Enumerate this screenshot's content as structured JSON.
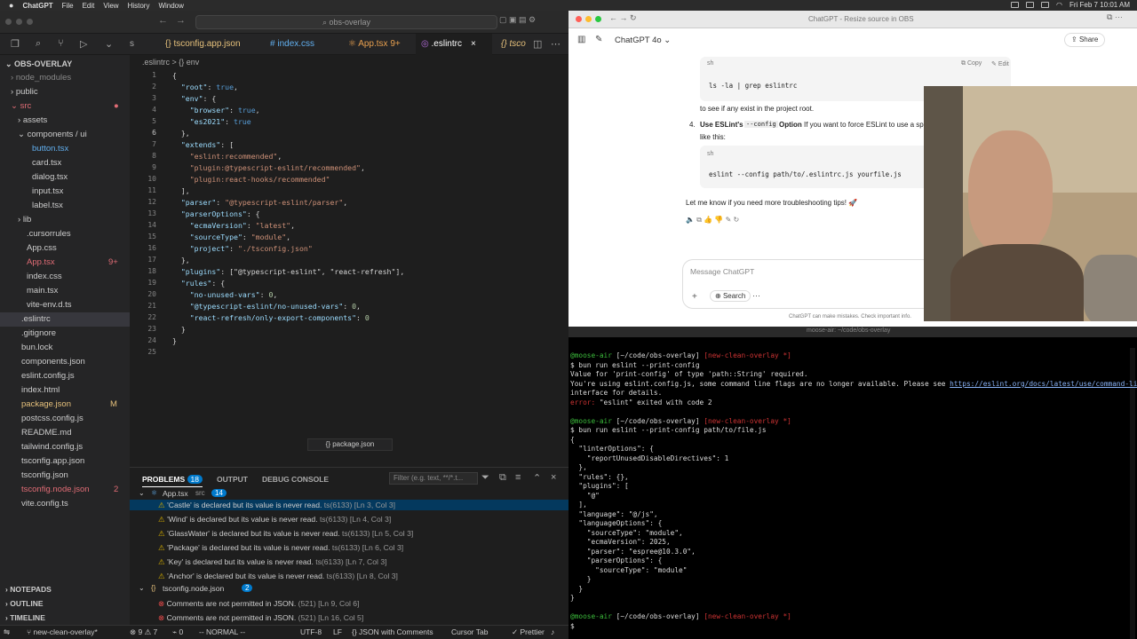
{
  "menubar": {
    "app": "ChatGPT",
    "items": [
      "File",
      "Edit",
      "View",
      "History",
      "Window"
    ],
    "clock": "Fri Feb 7  10:01 AM"
  },
  "vscode": {
    "search_placeholder": "obs-overlay",
    "tabs": [
      {
        "label": "s"
      },
      {
        "label": "tsconfig.app.json"
      },
      {
        "label": "index.css"
      },
      {
        "label": "App.tsx 9+"
      },
      {
        "label": ".eslintrc"
      },
      {
        "label": "tsco"
      }
    ],
    "explorer_title": "OBS-OVERLAY",
    "tree": [
      "node_modules",
      "public",
      "src",
      "assets",
      "components / ui",
      "button.tsx",
      "card.tsx",
      "dialog.tsx",
      "input.tsx",
      "label.tsx",
      "lib",
      ".cursorrules",
      "App.css",
      "App.tsx",
      "index.css",
      "main.tsx",
      "vite-env.d.ts",
      ".eslintrc",
      ".gitignore",
      "bun.lock",
      "components.json",
      "eslint.config.js",
      "index.html",
      "package.json",
      "postcss.config.js",
      "README.md",
      "tailwind.config.js",
      "tsconfig.app.json",
      "tsconfig.json",
      "tsconfig.node.json",
      "vite.config.ts"
    ],
    "badges": {
      "apptsx": "9+",
      "pkg": "M",
      "tsnode": "2"
    },
    "outline_sections": [
      "NOTEPADS",
      "OUTLINE",
      "TIMELINE"
    ],
    "breadcrumb": ".eslintrc  >  {} env",
    "line_numbers": [
      "1",
      "2",
      "3",
      "4",
      "5",
      "6",
      "7",
      "8",
      "9",
      "10",
      "11",
      "12",
      "13",
      "14",
      "15",
      "16",
      "17",
      "18",
      "19",
      "20",
      "21",
      "22",
      "23",
      "24",
      "25"
    ],
    "code_lines": [
      "{",
      "  \"root\": true,",
      "  \"env\": {",
      "    \"browser\": true,",
      "    \"es2021\": true",
      "  },",
      "  \"extends\": [",
      "    \"eslint:recommended\",",
      "    \"plugin:@typescript-eslint/recommended\",",
      "    \"plugin:react-hooks/recommended\"",
      "  ],",
      "  \"parser\": \"@typescript-eslint/parser\",",
      "  \"parserOptions\": {",
      "    \"ecmaVersion\": \"latest\",",
      "    \"sourceType\": \"module\",",
      "    \"project\": \"./tsconfig.json\"",
      "  },",
      "  \"plugins\": [\"@typescript-eslint\", \"react-refresh\"],",
      "  \"rules\": {",
      "    \"no-unused-vars\": 0,",
      "    \"@typescript-eslint/no-unused-vars\": 0,",
      "    \"react-refresh/only-export-components\": 0",
      "  }",
      "}",
      ""
    ],
    "sticky_hint": "{} package.json",
    "panel_tabs": {
      "problems": "PROBLEMS",
      "problems_count": "18",
      "output": "OUTPUT",
      "debug": "DEBUG CONSOLE",
      "filter_placeholder": "Filter (e.g. text, **/*.t..."
    },
    "problem_groups": [
      {
        "file": "App.tsx",
        "dir": "src",
        "count": "14"
      },
      {
        "file": "tsconfig.node.json",
        "dir": "",
        "count": "2"
      }
    ],
    "problems": [
      {
        "msg": "'Castle' is declared but its value is never read.",
        "code": "ts(6133)",
        "loc": "[Ln 3, Col 3]",
        "level": "warn"
      },
      {
        "msg": "'Wind' is declared but its value is never read.",
        "code": "ts(6133)",
        "loc": "[Ln 4, Col 3]",
        "level": "warn"
      },
      {
        "msg": "'GlassWater' is declared but its value is never read.",
        "code": "ts(6133)",
        "loc": "[Ln 5, Col 3]",
        "level": "warn"
      },
      {
        "msg": "'Package' is declared but its value is never read.",
        "code": "ts(6133)",
        "loc": "[Ln 6, Col 3]",
        "level": "warn"
      },
      {
        "msg": "'Key' is declared but its value is never read.",
        "code": "ts(6133)",
        "loc": "[Ln 7, Col 3]",
        "level": "warn"
      },
      {
        "msg": "'Anchor' is declared but its value is never read.",
        "code": "ts(6133)",
        "loc": "[Ln 8, Col 3]",
        "level": "warn"
      },
      {
        "msg": "Comments are not permitted in JSON.",
        "code": "(521)",
        "loc": "[Ln 9, Col 6]",
        "level": "err"
      },
      {
        "msg": "Comments are not permitted in JSON.",
        "code": "(521)",
        "loc": "[Ln 16, Col 5]",
        "level": "err"
      }
    ],
    "status": {
      "branch": "new-clean-overlay*",
      "errors": "⊗ 9 ⚠ 7",
      "ports": "⌁ 0",
      "mode": "-- NORMAL --",
      "encoding": "UTF-8",
      "eol": "LF",
      "lang": "{} JSON with Comments",
      "tab": "Cursor Tab",
      "prettier": "✓ Prettier"
    }
  },
  "chatgpt": {
    "title": "ChatGPT 4o",
    "share": "Share",
    "tab_title": "ChatGPT - Resize source in OBS",
    "code1_lang": "sh",
    "code1_copy": "Copy",
    "code1_edit": "Edit",
    "code1": "ls -la | grep eslintrc",
    "para1": "to see if any exist in the project root.",
    "step_num": "4.",
    "step_bold": "Use ESLint's",
    "step_code": "--config",
    "step_bold2": "Option",
    "step_text": "If you want to force ESLint to use a sp",
    "step_text2": "like this:",
    "code2_lang": "sh",
    "code2": "eslint --config path/to/.eslintrc.js yourfile.js",
    "para2": "Let me know if you need more troubleshooting tips! 🚀",
    "input_placeholder": "Message ChatGPT",
    "search_label": "Search",
    "disclaimer": "ChatGPT can make mistakes. Check important info."
  },
  "terminal": {
    "title": "moose-air: ~/code/obs-overlay",
    "lines": [
      {
        "t": "prompt",
        "user": "@moose-air",
        "path": "[~/code/obs-overlay]",
        "branch": "[new-clean-overlay *]"
      },
      {
        "t": "plain",
        "text": "$ bun run eslint --print-config"
      },
      {
        "t": "plain",
        "text": "Value for 'print-config' of type 'path::String' required."
      },
      {
        "t": "url",
        "pre": "You're using eslint.config.js, some command line flags are no longer available. Please see ",
        "url": "https://eslint.org/docs/latest/use/command-line-"
      },
      {
        "t": "plain",
        "text": "interface for details."
      },
      {
        "t": "error",
        "label": "error:",
        "text": " \"eslint\" exited with code 2"
      },
      {
        "t": "plain",
        "text": ""
      },
      {
        "t": "prompt",
        "user": "@moose-air",
        "path": "[~/code/obs-overlay]",
        "branch": "[new-clean-overlay *]"
      },
      {
        "t": "plain",
        "text": "$ bun run eslint --print-config path/to/file.js"
      },
      {
        "t": "plain",
        "text": "{"
      },
      {
        "t": "plain",
        "text": "  \"linterOptions\": {"
      },
      {
        "t": "plain",
        "text": "    \"reportUnusedDisableDirectives\": 1"
      },
      {
        "t": "plain",
        "text": "  },"
      },
      {
        "t": "plain",
        "text": "  \"rules\": {},"
      },
      {
        "t": "plain",
        "text": "  \"plugins\": ["
      },
      {
        "t": "plain",
        "text": "    \"@\""
      },
      {
        "t": "plain",
        "text": "  ],"
      },
      {
        "t": "plain",
        "text": "  \"language\": \"@/js\","
      },
      {
        "t": "plain",
        "text": "  \"languageOptions\": {"
      },
      {
        "t": "plain",
        "text": "    \"sourceType\": \"module\","
      },
      {
        "t": "plain",
        "text": "    \"ecmaVersion\": 2025,"
      },
      {
        "t": "plain",
        "text": "    \"parser\": \"espree@10.3.0\","
      },
      {
        "t": "plain",
        "text": "    \"parserOptions\": {"
      },
      {
        "t": "plain",
        "text": "      \"sourceType\": \"module\""
      },
      {
        "t": "plain",
        "text": "    }"
      },
      {
        "t": "plain",
        "text": "  }"
      },
      {
        "t": "plain",
        "text": "}"
      },
      {
        "t": "plain",
        "text": ""
      },
      {
        "t": "prompt",
        "user": "@moose-air",
        "path": "[~/code/obs-overlay]",
        "branch": "[new-clean-overlay *]"
      },
      {
        "t": "plain",
        "text": "$ "
      }
    ]
  },
  "colors": {
    "accent": "#007acc",
    "warning": "#cca700",
    "error": "#f14c4c",
    "prompt_green": "#3cbd3c",
    "branch_red": "#cc3333"
  }
}
